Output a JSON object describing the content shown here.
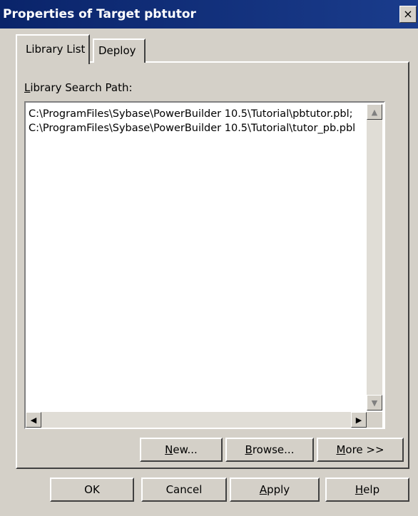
{
  "window": {
    "title": "Properties of Target pbtutor",
    "close_glyph": "×"
  },
  "tabs": [
    {
      "label": "Library List",
      "active": true
    },
    {
      "label": "Deploy",
      "active": false
    }
  ],
  "library_search": {
    "label_first": "L",
    "label_rest": "ibrary Search Path:",
    "paths": [
      "C:\\ProgramFiles\\Sybase\\PowerBuilder 10.5\\Tutorial\\pbtutor.pbl;",
      "C:\\ProgramFiles\\Sybase\\PowerBuilder 10.5\\Tutorial\\tutor_pb.pbl"
    ]
  },
  "panel_buttons": {
    "new": {
      "mnemonic": "N",
      "rest": "ew..."
    },
    "browse": {
      "mnemonic": "B",
      "rest": "rowse..."
    },
    "more": {
      "mnemonic": "M",
      "rest": "ore >>"
    }
  },
  "dialog_buttons": {
    "ok": "OK",
    "cancel": "Cancel",
    "apply": {
      "mnemonic": "A",
      "rest": "pply"
    },
    "help": {
      "mnemonic": "H",
      "rest": "elp"
    }
  },
  "icons": {
    "scroll_up": "▲",
    "scroll_down": "▼",
    "scroll_left": "◀",
    "scroll_right": "▶"
  },
  "colors": {
    "title_bar": "#0a246a",
    "dialog_face": "#d4d0c8"
  }
}
